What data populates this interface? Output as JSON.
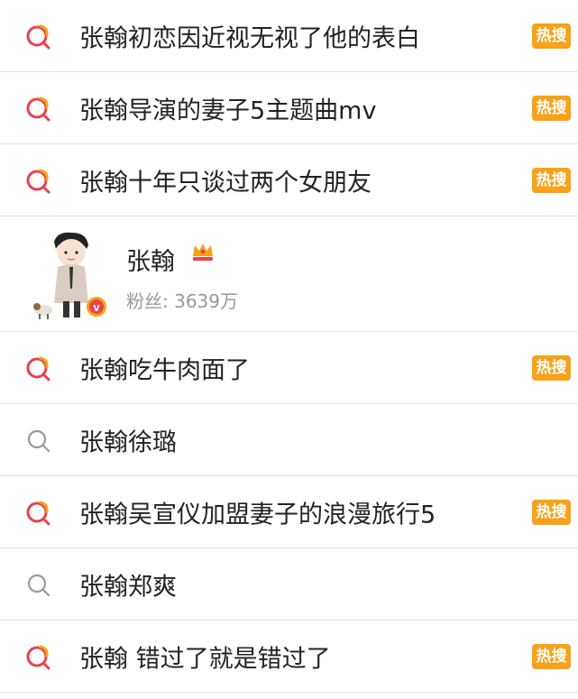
{
  "results": [
    {
      "text": "张翰初恋因近视无视了他的表白",
      "hot": true,
      "hot_label": "热搜"
    },
    {
      "text": "张翰导演的妻子5主题曲mv",
      "hot": true,
      "hot_label": "热搜"
    },
    {
      "text": "张翰十年只谈过两个女朋友",
      "hot": true,
      "hot_label": "热搜"
    }
  ],
  "user": {
    "name": "张翰",
    "fans_label": "粉丝:",
    "fans_count": "3639万",
    "verified_glyph": "v"
  },
  "results2": [
    {
      "text": "张翰吃牛肉面了",
      "hot": true,
      "hot_label": "热搜"
    },
    {
      "text": "张翰徐璐",
      "hot": false
    },
    {
      "text": "张翰吴宣仪加盟妻子的浪漫旅行5",
      "hot": true,
      "hot_label": "热搜"
    },
    {
      "text": "张翰郑爽",
      "hot": false
    },
    {
      "text": "张翰 错过了就是错过了",
      "hot": true,
      "hot_label": "热搜"
    }
  ],
  "colors": {
    "hot_badge": "#f7a219",
    "hot_icon_ring": "#e8424f",
    "plain_icon": "#9a9a9a"
  }
}
